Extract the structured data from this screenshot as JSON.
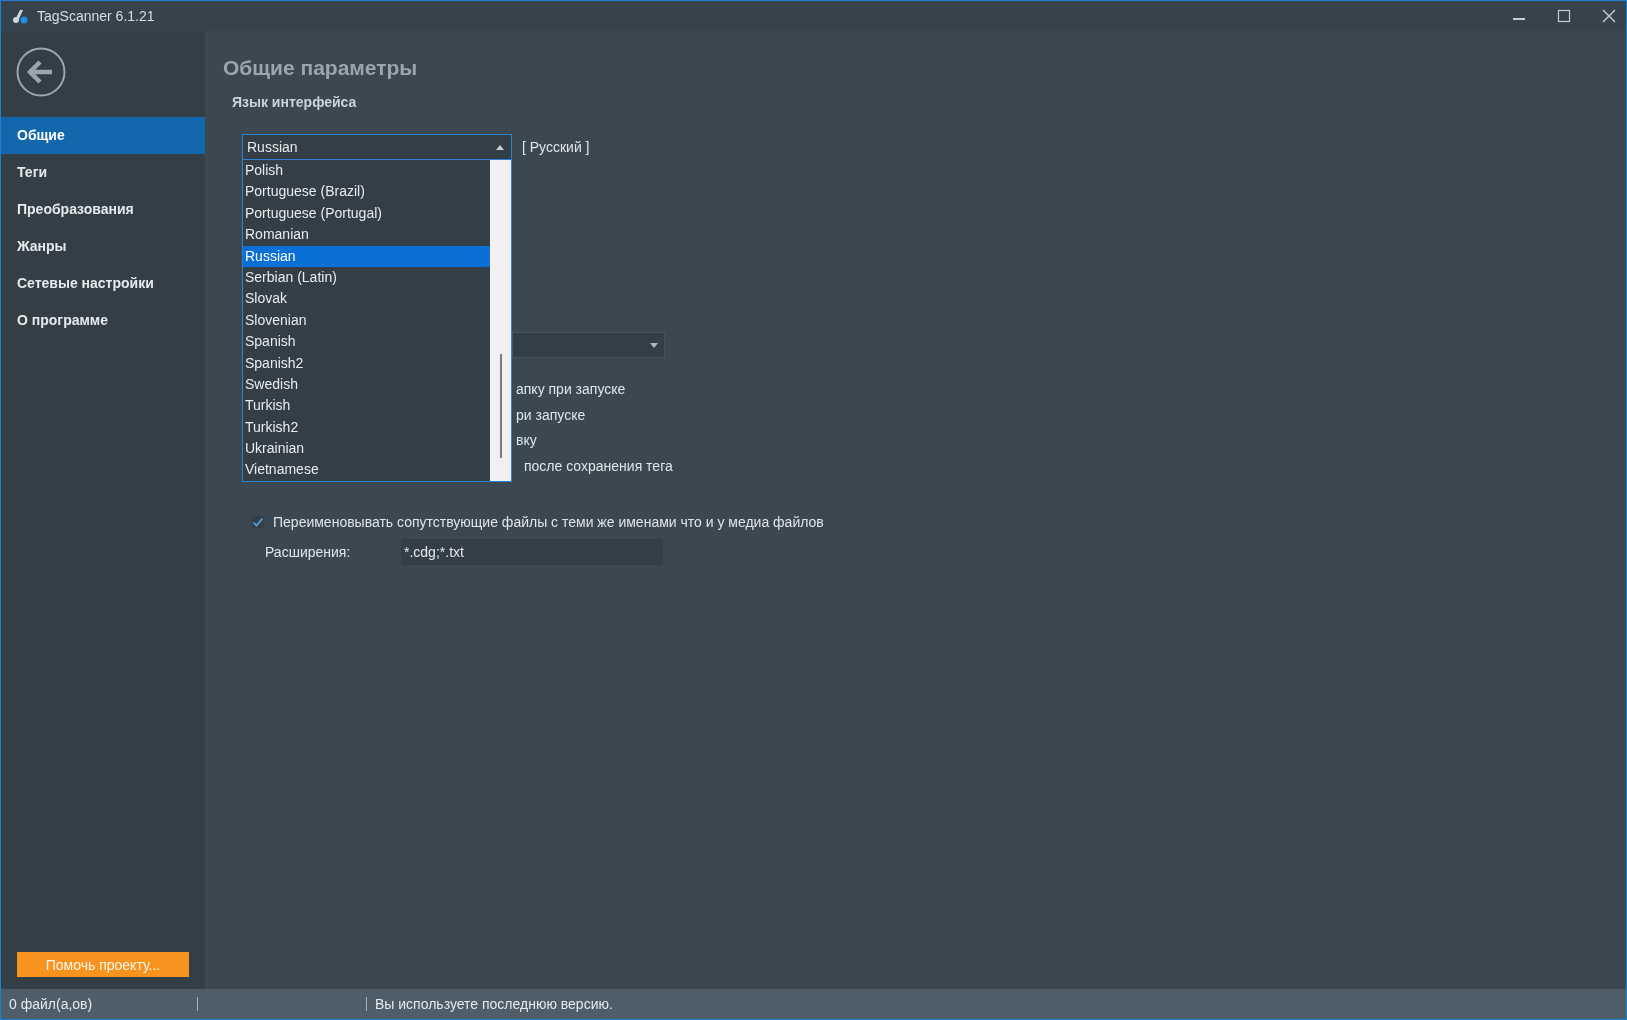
{
  "window": {
    "title": "TagScanner 6.1.21"
  },
  "sidebar": {
    "items": [
      {
        "label": "Общие",
        "selected": true
      },
      {
        "label": "Теги",
        "selected": false
      },
      {
        "label": "Преобразования",
        "selected": false
      },
      {
        "label": "Жанры",
        "selected": false
      },
      {
        "label": "Сетевые настройки",
        "selected": false
      },
      {
        "label": "О программе",
        "selected": false
      }
    ],
    "help_button": "Помочь проекту..."
  },
  "page": {
    "title": "Общие параметры",
    "section": "Язык интерфейса",
    "language": {
      "value": "Russian",
      "native_name": "[ Русский ]",
      "options": [
        {
          "label": "Polish",
          "selected": false
        },
        {
          "label": "Portuguese (Brazil)",
          "selected": false
        },
        {
          "label": "Portuguese (Portugal)",
          "selected": false
        },
        {
          "label": "Romanian",
          "selected": false
        },
        {
          "label": "Russian",
          "selected": true
        },
        {
          "label": "Serbian (Latin)",
          "selected": false
        },
        {
          "label": "Slovak",
          "selected": false
        },
        {
          "label": "Slovenian",
          "selected": false
        },
        {
          "label": "Spanish",
          "selected": false
        },
        {
          "label": "Spanish2",
          "selected": false
        },
        {
          "label": "Swedish",
          "selected": false
        },
        {
          "label": "Turkish",
          "selected": false
        },
        {
          "label": "Turkish2",
          "selected": false
        },
        {
          "label": "Ukrainian",
          "selected": false
        },
        {
          "label": "Vietnamese",
          "selected": false
        }
      ]
    },
    "partly_hidden_options": [
      "апку при запуске",
      "ри запуске",
      "вку",
      "после сохранения тега"
    ],
    "rename_companion": {
      "label": "Переименовывать сопутствующие файлы с теми же именами что и у медиа файлов",
      "checked": true
    },
    "extensions": {
      "label": "Расширения:",
      "value": "*.cdg;*.txt"
    }
  },
  "status_bar": {
    "files": "0 файл(а,ов)",
    "message": "Вы используете последнюю версию."
  }
}
